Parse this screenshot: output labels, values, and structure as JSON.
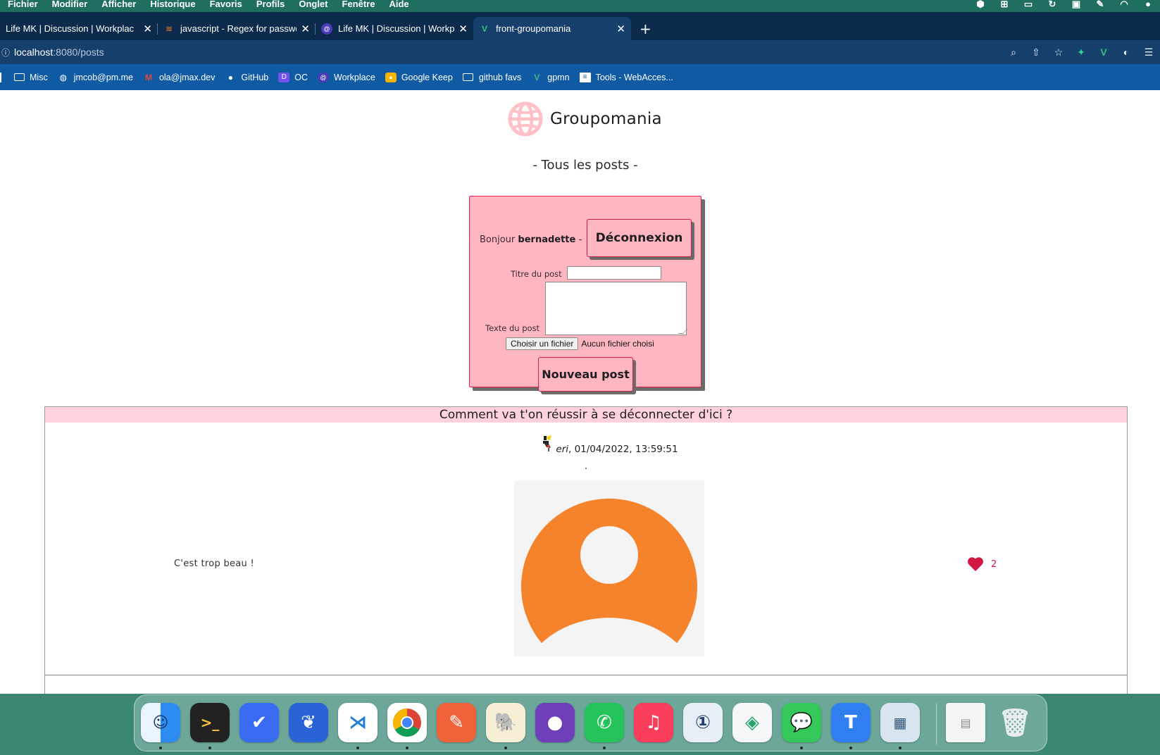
{
  "menubar": {
    "items": [
      "Fichier",
      "Modifier",
      "Afficher",
      "Historique",
      "Favoris",
      "Profils",
      "Onglet",
      "Fenêtre",
      "Aide"
    ]
  },
  "tabs": [
    {
      "title": "Life MK | Discussion | Workplac",
      "favicon": "workplace-icon",
      "active": false
    },
    {
      "title": "javascript - Regex for password",
      "favicon": "stackoverflow-icon",
      "active": false
    },
    {
      "title": "Life MK | Discussion | Workplac",
      "favicon": "workplace-icon",
      "active": false
    },
    {
      "title": "front-groupomania",
      "favicon": "vue-icon",
      "active": true
    }
  ],
  "address": {
    "host": "localhost",
    "path": ":8080/posts"
  },
  "bookmarks": [
    {
      "label": "Misc",
      "icon": "folder-icon"
    },
    {
      "label": "jmcob@pm.me",
      "icon": "protonmail-icon"
    },
    {
      "label": "ola@jmax.dev",
      "icon": "gmail-icon"
    },
    {
      "label": "GitHub",
      "icon": "github-icon"
    },
    {
      "label": "OC",
      "icon": "openclassrooms-icon"
    },
    {
      "label": "Workplace",
      "icon": "workplace-icon"
    },
    {
      "label": "Google Keep",
      "icon": "google-keep-icon"
    },
    {
      "label": "github favs",
      "icon": "folder-icon"
    },
    {
      "label": "gpmn",
      "icon": "vue-icon"
    },
    {
      "label": "Tools - WebAcces...",
      "icon": "page-icon"
    }
  ],
  "app": {
    "brand": "Groupomania",
    "subtitle": "- Tous les posts -"
  },
  "form": {
    "greeting_prefix": "Bonjour",
    "username": "bernadette",
    "greeting_suffix": " -",
    "logout_label": "Déconnexion",
    "title_label": "Titre du post",
    "title_value": "",
    "text_label": "Texte du post",
    "text_value": "",
    "file_button": "Choisir un fichier",
    "file_status": "Aucun fichier choisi",
    "submit_label": "Nouveau post"
  },
  "posts": [
    {
      "title": "Comment va t'on réussir à se déconnecter d'ici ?",
      "author": "eri",
      "date": ", 01/04/2022, 13:59:51",
      "body": "C'est trop beau !",
      "likes": "2"
    }
  ],
  "colors": {
    "card_bg": "#ffb6c1",
    "card_border": "#e8234a",
    "post_header": "#ffd1da",
    "like": "#d01842",
    "avatar_orange": "#f5832c"
  },
  "dock": {
    "apps": [
      "finder",
      "terminal",
      "things",
      "coral",
      "vscode",
      "chrome",
      "postman",
      "tableplus",
      "github-desktop",
      "whatsapp",
      "music",
      "1password",
      "stacks",
      "messages",
      "typora",
      "preview",
      "documents",
      "trash"
    ]
  }
}
